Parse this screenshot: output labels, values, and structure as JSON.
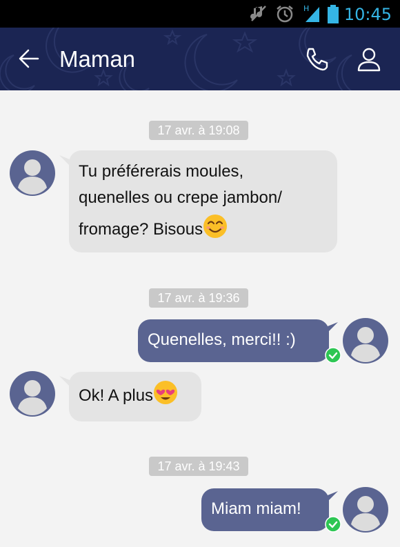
{
  "status_bar": {
    "time": "10:45",
    "icons": [
      "mute-icon",
      "alarm-icon",
      "signal-icon",
      "battery-icon"
    ]
  },
  "app_bar": {
    "title": "Maman",
    "icons": [
      "back-arrow-icon",
      "phone-icon",
      "contact-icon"
    ]
  },
  "conversation": {
    "timestamps": [
      "17 avr. à 19:08",
      "17 avr. à 19:36",
      "17 avr. à 19:43"
    ],
    "messages": [
      {
        "direction": "incoming",
        "line1": "Tu préférerais moules,",
        "line2": "quenelles ou crepe jambon/",
        "line3": "fromage? Bisous",
        "emoji": "smiling-face-emoji"
      },
      {
        "direction": "outgoing",
        "text": "Quenelles, merci!! :)",
        "status": "delivered-check-icon"
      },
      {
        "direction": "incoming",
        "text": "Ok! A plus",
        "emoji": "heart-eyes-emoji"
      },
      {
        "direction": "outgoing",
        "text": "Miam miam!",
        "status": "delivered-check-icon"
      }
    ]
  },
  "colors": {
    "app_bar": "#1b2553",
    "status_accent": "#35b5e5",
    "incoming_bubble": "#e4e4e4",
    "outgoing_bubble": "#5a6491",
    "check": "#2dc653",
    "timestamp_pill": "#c9c9c9"
  }
}
